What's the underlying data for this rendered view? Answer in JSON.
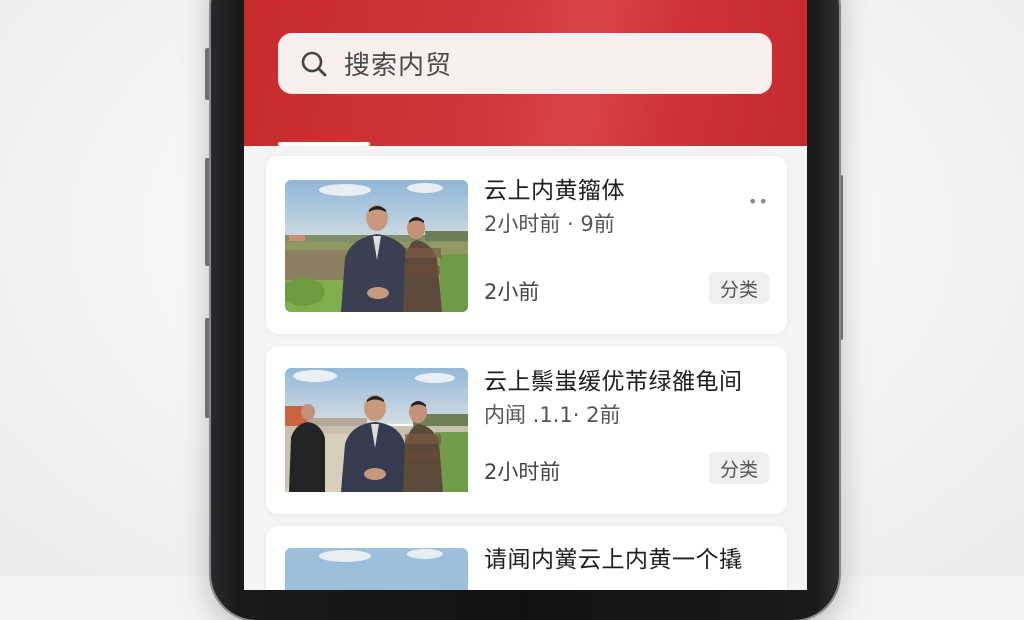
{
  "search": {
    "placeholder": "搜索内贸"
  },
  "feed": {
    "items": [
      {
        "title": "云上内黄籀体",
        "meta": "2小时前 · 9前",
        "time": "2小前",
        "tag": "分类",
        "has_more": true
      },
      {
        "title": "云上鬃蚩缓优芾绿雒龟间",
        "meta": "内闻  .1.1· 2前",
        "time": "2小时前",
        "tag": "分类",
        "has_more": false
      },
      {
        "title": "请闻内黉云上内黄一个撬",
        "meta": "",
        "time": "",
        "tag": "",
        "has_more": false
      }
    ]
  },
  "colors": {
    "header": "#cf3337",
    "card": "#ffffff",
    "tag_bg": "#efefef"
  },
  "icons": {
    "search": "search-icon",
    "more": "more-dots-icon"
  }
}
